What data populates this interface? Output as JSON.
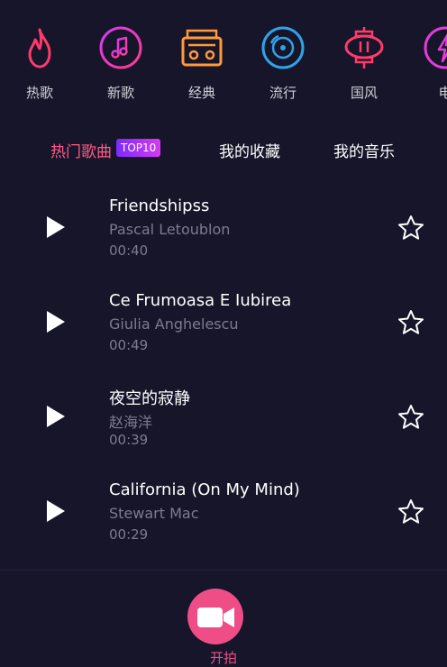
{
  "categories": [
    {
      "label": "热歌",
      "icon": "flame-icon",
      "color": "#ff3b6b"
    },
    {
      "label": "新歌",
      "icon": "music-note-icon",
      "color": "#e23bd8"
    },
    {
      "label": "经典",
      "icon": "radio-icon",
      "color": "#ff9a3c"
    },
    {
      "label": "流行",
      "icon": "vinyl-disc-icon",
      "color": "#2fa3e8"
    },
    {
      "label": "国风",
      "icon": "lantern-icon",
      "color": "#ff3b6b"
    },
    {
      "label": "电",
      "icon": "lightning-icon",
      "color": "#e23bd8"
    }
  ],
  "tabs": {
    "hot": "热门歌曲",
    "badge": "TOP10",
    "favorites": "我的收藏",
    "my_music": "我的音乐"
  },
  "songs": [
    {
      "title": "Friendshipss",
      "artist": "Pascal Letoublon",
      "duration": "00:40"
    },
    {
      "title": "Ce Frumoasa E Iubirea",
      "artist": "Giulia Anghelescu",
      "duration": "00:49"
    },
    {
      "title": "夜空的寂静",
      "artist": "赵海洋",
      "duration": "00:39"
    },
    {
      "title": "California (On My Mind)",
      "artist": "Stewart Mac",
      "duration": "00:29"
    }
  ],
  "bottom": {
    "record_label": "开拍"
  },
  "colors": {
    "background": "#17152a",
    "accent": "#ff5c8a",
    "record_button": "#ef4d86"
  }
}
